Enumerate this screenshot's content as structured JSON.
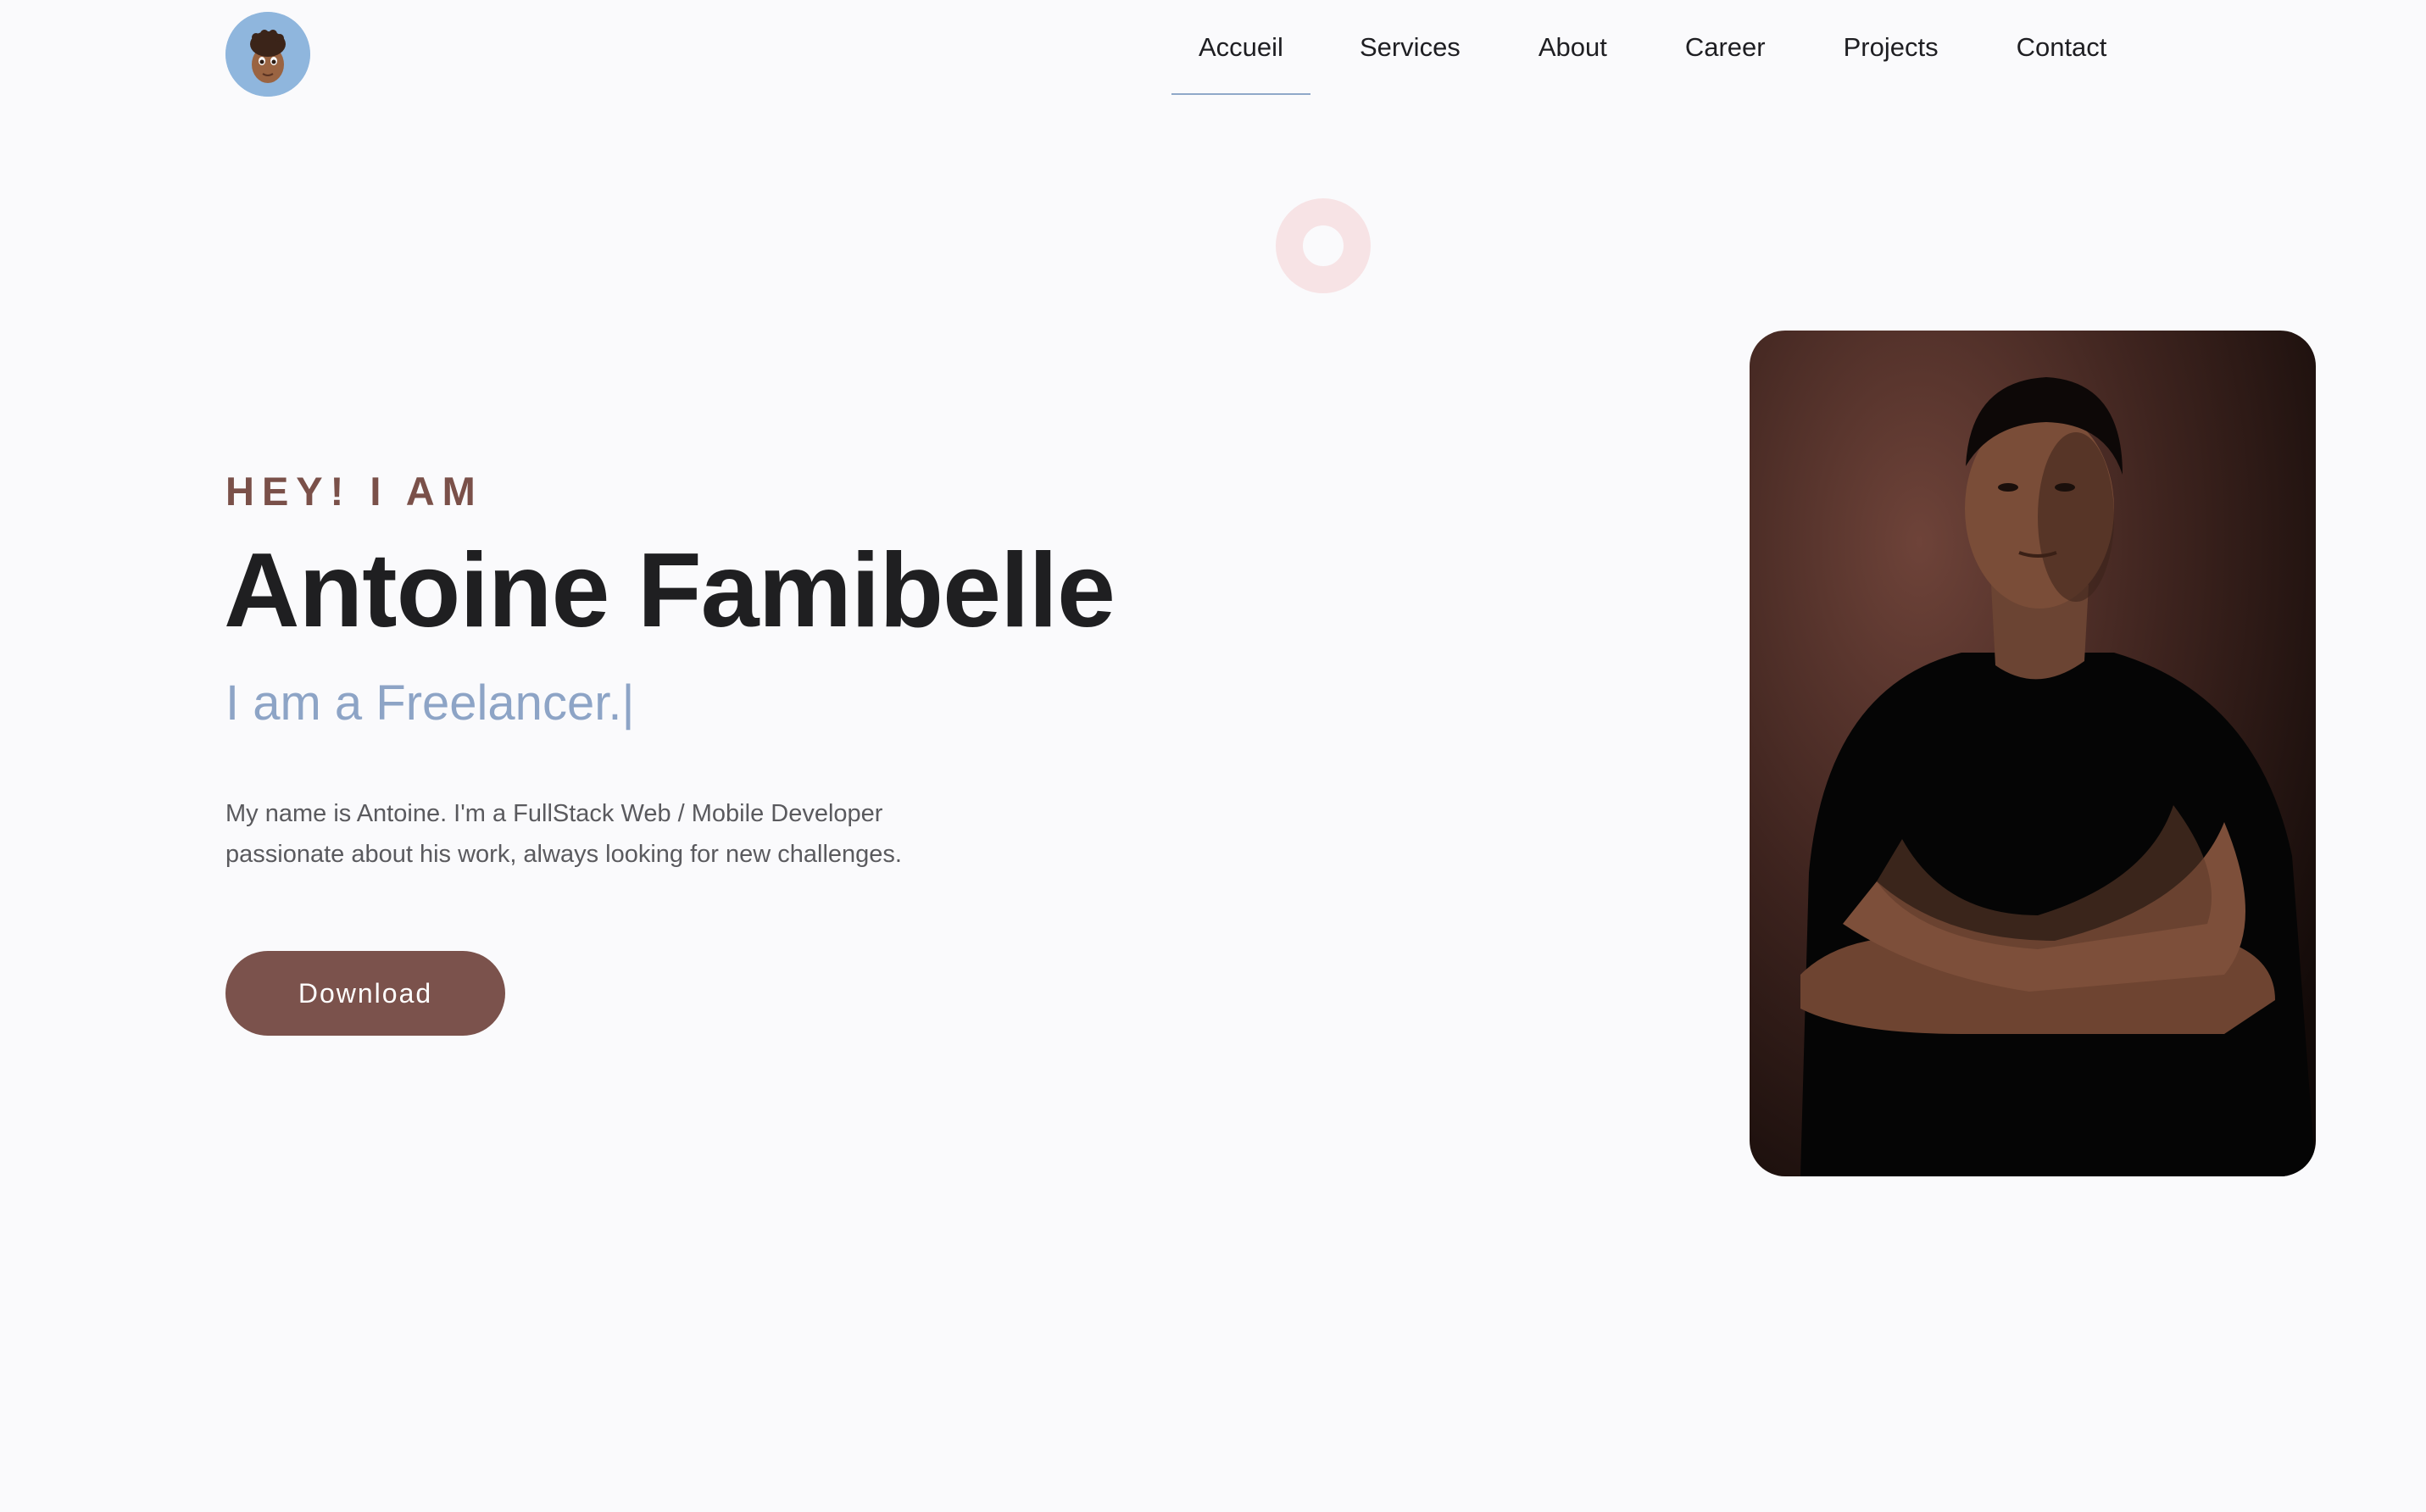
{
  "header": {
    "nav": [
      {
        "label": "Accueil",
        "active": true
      },
      {
        "label": "Services",
        "active": false
      },
      {
        "label": "About",
        "active": false
      },
      {
        "label": "Career",
        "active": false
      },
      {
        "label": "Projects",
        "active": false
      },
      {
        "label": "Contact",
        "active": false
      }
    ]
  },
  "hero": {
    "eyebrow": "HEY! I AM",
    "name": "Antoine Famibelle",
    "role_text": "I am a Freelancer.",
    "role_caret": "|",
    "intro_line1": "My name is Antoine. I'm a FullStack Web / Mobile Developer",
    "intro_line2": "passionate about his work, always looking for new challenges.",
    "download_label": "Download"
  },
  "colors": {
    "background": "#fafafc",
    "accent_brown": "#7b524c",
    "accent_blue": "#8da4c6",
    "ring_pink": "#f7e3e5",
    "text_dark": "#1f1f21"
  },
  "icons": {
    "logo": "memoji-avatar-icon",
    "ring": "ring-decoration-icon"
  }
}
